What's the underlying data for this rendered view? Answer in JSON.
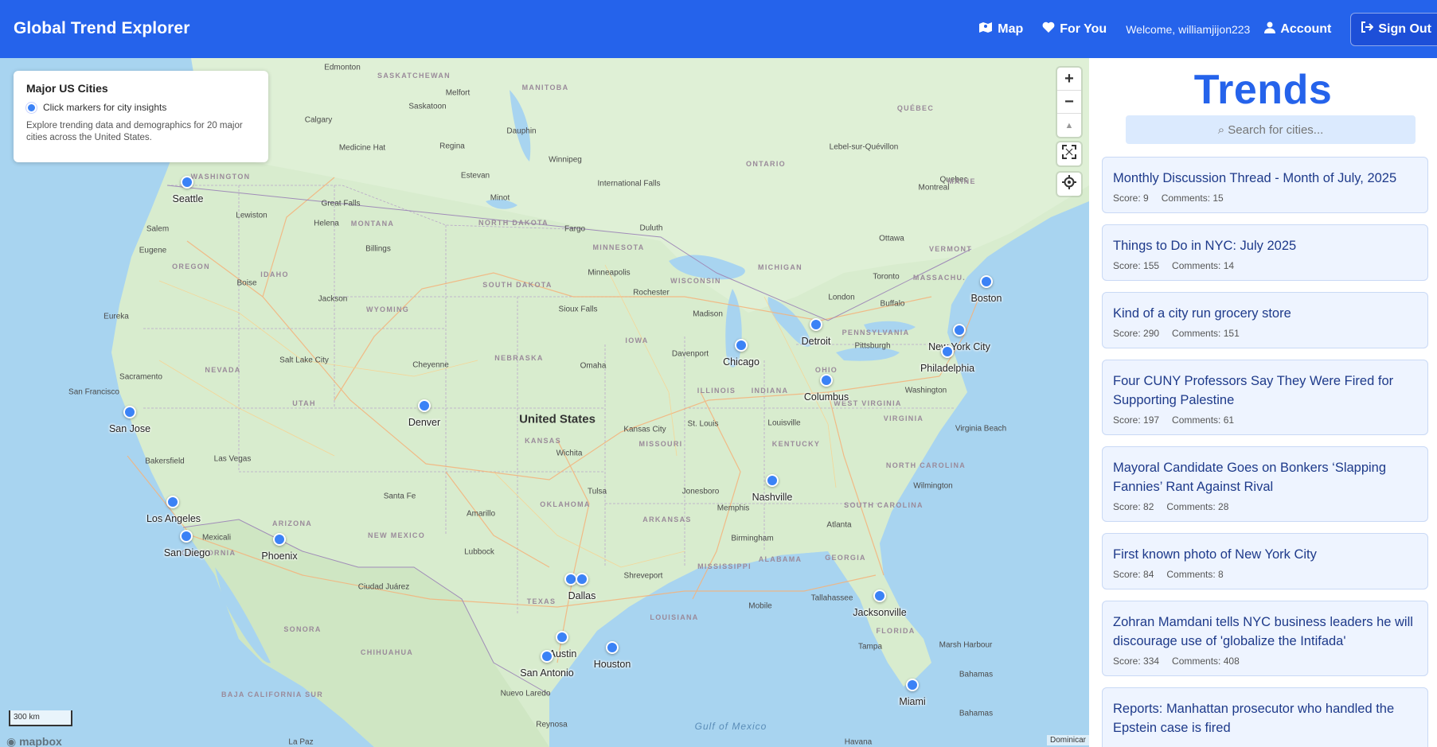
{
  "app": {
    "title": "Global Trend Explorer"
  },
  "nav": {
    "map_label": "Map",
    "for_you_label": "For You",
    "welcome": "Welcome, williamjijon223",
    "account_label": "Account",
    "signout_label": "Sign Out"
  },
  "legend": {
    "title": "Major US Cities",
    "marker_hint": "Click markers for city insights",
    "description": "Explore trending data and demographics for 20 major cities across the United States."
  },
  "map": {
    "zoom_in": "+",
    "zoom_out": "−",
    "compass": "▲",
    "fullscreen": "⛶",
    "locate": "◎",
    "scale_label": "300 km",
    "logo": "mapbox",
    "attribution": "Dominicar",
    "country_label": "United States",
    "markers": [
      "Seattle",
      "San Jose",
      "Los Angeles",
      "San Diego",
      "Phoenix",
      "Denver",
      "Dallas",
      "Austin",
      "San Antonio",
      "Houston",
      "Chicago",
      "Detroit",
      "Columbus",
      "Nashville",
      "Jacksonville",
      "Miami",
      "New York City",
      "Philadelphia",
      "Boston"
    ]
  },
  "sidebar": {
    "title": "Trends",
    "search_placeholder": "⌕ Search for cities...",
    "posts": [
      {
        "title": "Monthly Discussion Thread - Month of July, 2025",
        "score": "Score: 9",
        "comments": "Comments: 15"
      },
      {
        "title": "Things to Do in NYC: July 2025",
        "score": "Score: 155",
        "comments": "Comments: 14"
      },
      {
        "title": "Kind of a city run grocery store",
        "score": "Score: 290",
        "comments": "Comments: 151"
      },
      {
        "title": "Four CUNY Professors Say They Were Fired for Supporting Palestine",
        "score": "Score: 197",
        "comments": "Comments: 61"
      },
      {
        "title": "Mayoral Candidate Goes on Bonkers ‘Slapping Fannies’ Rant Against Rival",
        "score": "Score: 82",
        "comments": "Comments: 28"
      },
      {
        "title": "First known photo of New York City",
        "score": "Score: 84",
        "comments": "Comments: 8"
      },
      {
        "title": "Zohran Mamdani tells NYC business leaders he will discourage use of 'globalize the Intifada'",
        "score": "Score: 334",
        "comments": "Comments: 408"
      },
      {
        "title": "Reports: Manhattan prosecutor who handled the Epstein case is fired",
        "score": "",
        "comments": ""
      }
    ]
  },
  "colors": {
    "brand": "#2563eb",
    "marker": "#3b82f6",
    "card_bg": "#eef4ff",
    "card_title": "#1e3a8a"
  }
}
